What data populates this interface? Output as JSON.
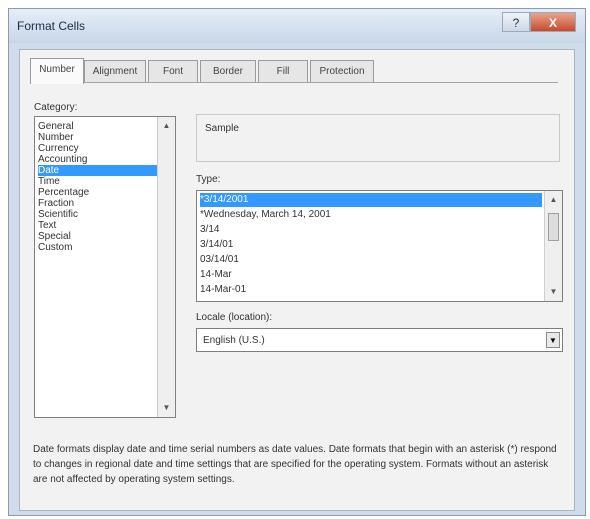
{
  "window": {
    "title": "Format Cells",
    "help_button": "?",
    "close_button": "X"
  },
  "tabs": [
    "Number",
    "Alignment",
    "Font",
    "Border",
    "Fill",
    "Protection"
  ],
  "category": {
    "label": "Category:",
    "items": [
      "General",
      "Number",
      "Currency",
      "Accounting",
      "Date",
      "Time",
      "Percentage",
      "Fraction",
      "Scientific",
      "Text",
      "Special",
      "Custom"
    ],
    "selected": "Date"
  },
  "sample": {
    "label": "Sample"
  },
  "type": {
    "label": "Type:",
    "items": [
      "*3/14/2001",
      "*Wednesday, March 14, 2001",
      "3/14",
      "3/14/01",
      "03/14/01",
      "14-Mar",
      "14-Mar-01"
    ],
    "selected": "*3/14/2001"
  },
  "locale": {
    "label": "Locale (location):",
    "value": "English (U.S.)"
  },
  "description": "Date formats display date and time serial numbers as date values. Date formats that begin with an asterisk (*) respond to changes in regional date and time settings that are specified for the operating system. Formats without an asterisk are not affected by operating system settings."
}
